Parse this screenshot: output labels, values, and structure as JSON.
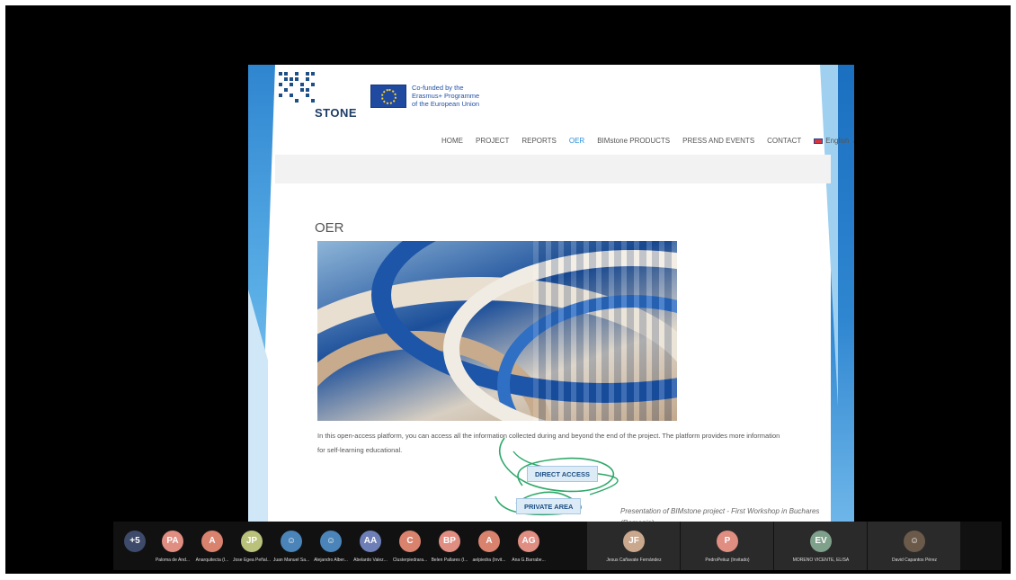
{
  "site": {
    "logo_text": "STONE",
    "logo_overlay": "BIM",
    "eu_text": [
      "Co-funded by the",
      "Erasmus+ Programme",
      "of the European Union"
    ],
    "nav": [
      "HOME",
      "PROJECT",
      "REPORTS",
      "OER",
      "BIMstone PRODUCTS",
      "PRESS AND EVENTS",
      "CONTACT"
    ],
    "active_nav": "OER",
    "language": "English",
    "page_title": "OER",
    "description": "In this open-access platform, you can access all the information collected during and beyond the end of the project. The platform provides more information for self-learning educational.",
    "direct_access_label": "DIRECT ACCESS",
    "private_area_label": "PRIVATE AREA",
    "caption": "Presentation of BIMstone project - First Workshop in Buchares (Romania)"
  },
  "participants": {
    "overflow_count": "+5",
    "small": [
      {
        "initials": "PA",
        "name": "Paloma de And...",
        "color": "#e08d82"
      },
      {
        "initials": "A",
        "name": "Anarquitecta (I...",
        "color": "#d9826e"
      },
      {
        "initials": "JP",
        "name": "Jose Egea Peñal...",
        "color": "#b9c17a"
      },
      {
        "initials": "",
        "name": "Juan Manuel Sa...",
        "color": "#4a84b8"
      },
      {
        "initials": "",
        "name": "Alejandro Alber...",
        "color": "#4a84b8"
      },
      {
        "initials": "AA",
        "name": "Abelardo Valez...",
        "color": "#6e7fb8"
      },
      {
        "initials": "C",
        "name": "Clusterpiedrara...",
        "color": "#d9826e"
      },
      {
        "initials": "BP",
        "name": "Belen Pallares (I...",
        "color": "#e08d82"
      },
      {
        "initials": "A",
        "name": "aelpiedra (Invit...",
        "color": "#d9826e"
      },
      {
        "initials": "AG",
        "name": "Ana G.Barrabe...",
        "color": "#e08d82"
      }
    ],
    "large": [
      {
        "initials": "JF",
        "name": "Jesus Cañavate Fernández",
        "color": "#c9a88e"
      },
      {
        "initials": "P",
        "name": "PedroPeiiuz (Invitado)",
        "color": "#e08d82"
      },
      {
        "initials": "EV",
        "name": "MORENO VICENTE, ELISA",
        "color": "#7fa08a"
      },
      {
        "initials": "",
        "name": "David Capantos Pérez",
        "color": "#6b5a4a"
      }
    ]
  }
}
